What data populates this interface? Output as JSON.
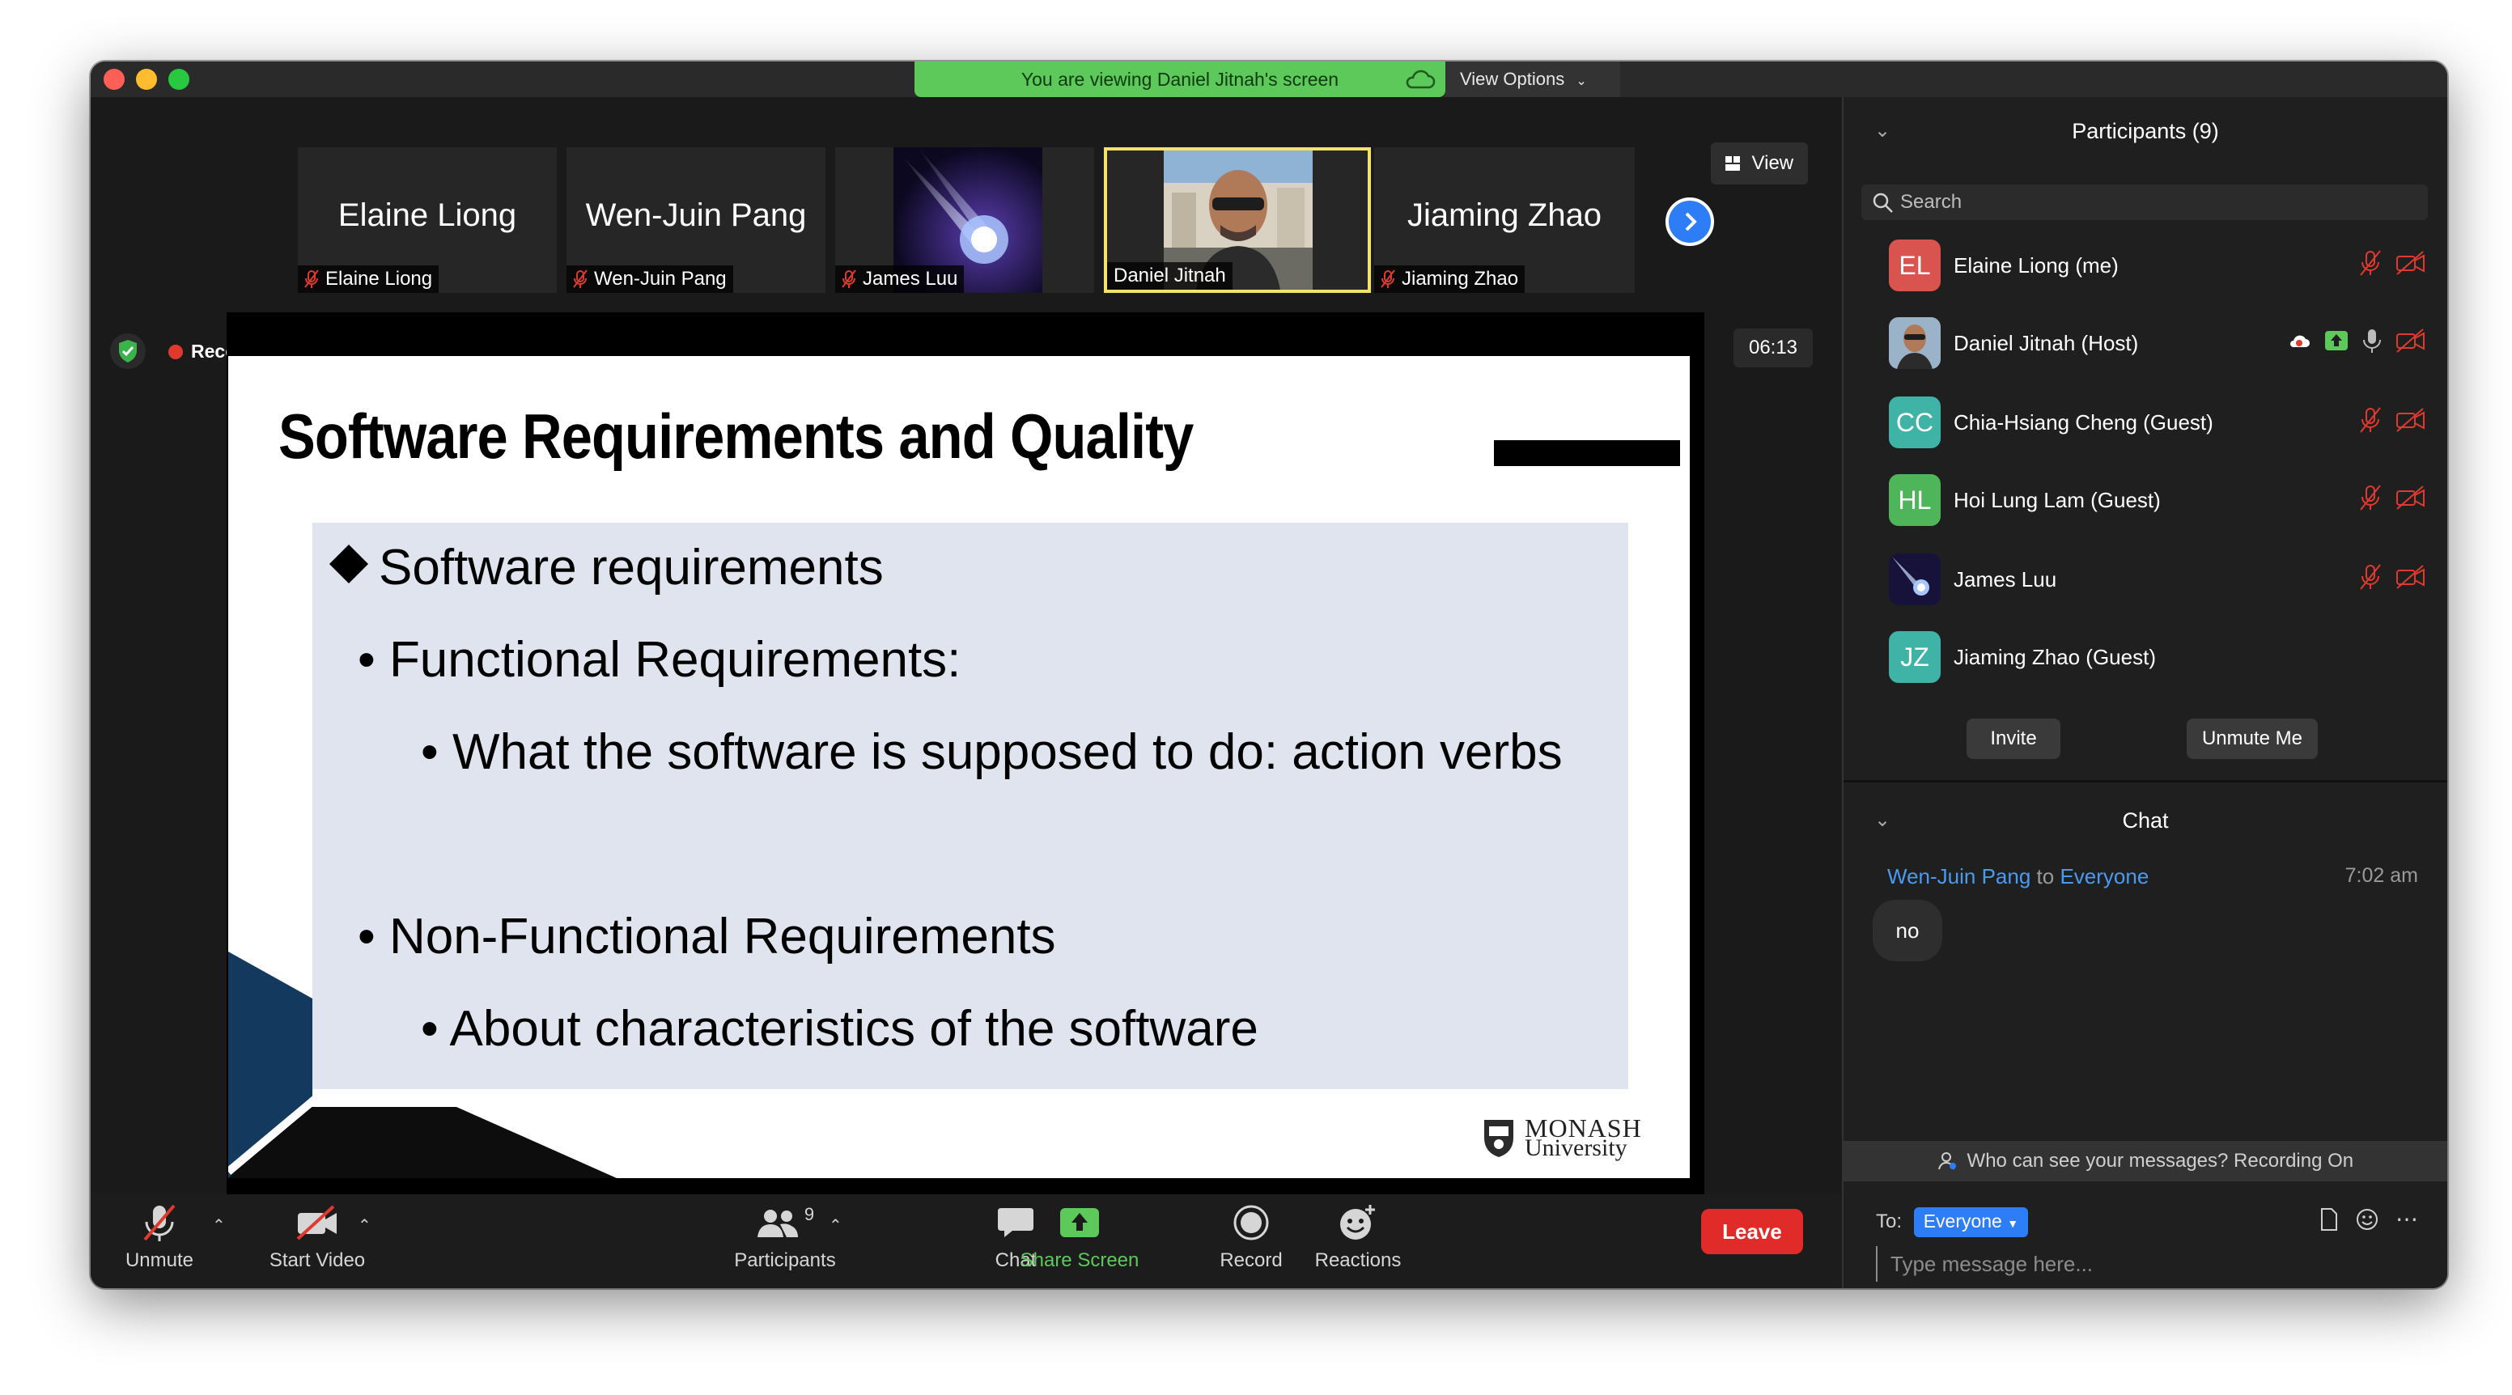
{
  "banner": {
    "text": "You are viewing Daniel Jitnah's screen",
    "view_options": "View Options"
  },
  "gallery": {
    "tiles": [
      {
        "big_name": "Elaine Liong",
        "tag": "Elaine Liong"
      },
      {
        "big_name": "Wen-Juin Pang",
        "tag": "Wen-Juin Pang"
      },
      {
        "big_name": "",
        "tag": "James Luu"
      },
      {
        "big_name": "",
        "tag": "Daniel Jitnah"
      },
      {
        "big_name": "Jiaming Zhao",
        "tag": "Jiaming Zhao"
      }
    ],
    "view_label": "View"
  },
  "recording": {
    "label": "Recording",
    "timer": "06:13"
  },
  "slide": {
    "title": "Software Requirements and Quality",
    "bullets": [
      "Software requirements",
      "Functional Requirements:",
      "What the software is supposed to do: action verbs",
      "Non-Functional Requirements",
      "About characteristics of the software"
    ],
    "logo_name": "MONASH",
    "logo_sub": "University"
  },
  "toolbar": {
    "unmute": "Unmute",
    "start_video": "Start Video",
    "participants": "Participants",
    "participants_count": "9",
    "chat": "Chat",
    "share_screen": "Share Screen",
    "record": "Record",
    "reactions": "Reactions",
    "leave": "Leave"
  },
  "participants_panel": {
    "title": "Participants (9)",
    "search_placeholder": "Search",
    "people": [
      {
        "initials": "EL",
        "name": "Elaine Liong (me)",
        "color": "#d9534f"
      },
      {
        "initials": "",
        "name": "Daniel Jitnah (Host)",
        "color": "#777777"
      },
      {
        "initials": "CC",
        "name": "Chia-Hsiang Cheng (Guest)",
        "color": "#3fb4a6"
      },
      {
        "initials": "HL",
        "name": "Hoi Lung Lam (Guest)",
        "color": "#4fb55a"
      },
      {
        "initials": "",
        "name": "James Luu",
        "color": "#3a2b6e"
      },
      {
        "initials": "JZ",
        "name": "Jiaming Zhao (Guest)",
        "color": "#3fb4a6"
      }
    ],
    "invite": "Invite",
    "unmute_me": "Unmute Me"
  },
  "chat_panel": {
    "title": "Chat",
    "sender": "Wen-Juin Pang",
    "to_word": "to",
    "recipient": "Everyone",
    "time": "7:02 am",
    "message": "no",
    "visibility_notice": "Who can see your messages? Recording On",
    "to_label": "To:",
    "to_value": "Everyone",
    "input_placeholder": "Type message here..."
  },
  "colors": {
    "share_green": "#5cc95a",
    "leave_red": "#e02b28",
    "accent_blue": "#2d7df6",
    "active_speaker": "#f4e36b"
  },
  "icons": [
    "shield-icon",
    "mic-muted-icon",
    "video-off-icon",
    "participants-icon",
    "chat-icon",
    "share-screen-icon",
    "record-icon",
    "reactions-icon",
    "search-icon",
    "cloud-icon",
    "chevron-right-icon"
  ]
}
